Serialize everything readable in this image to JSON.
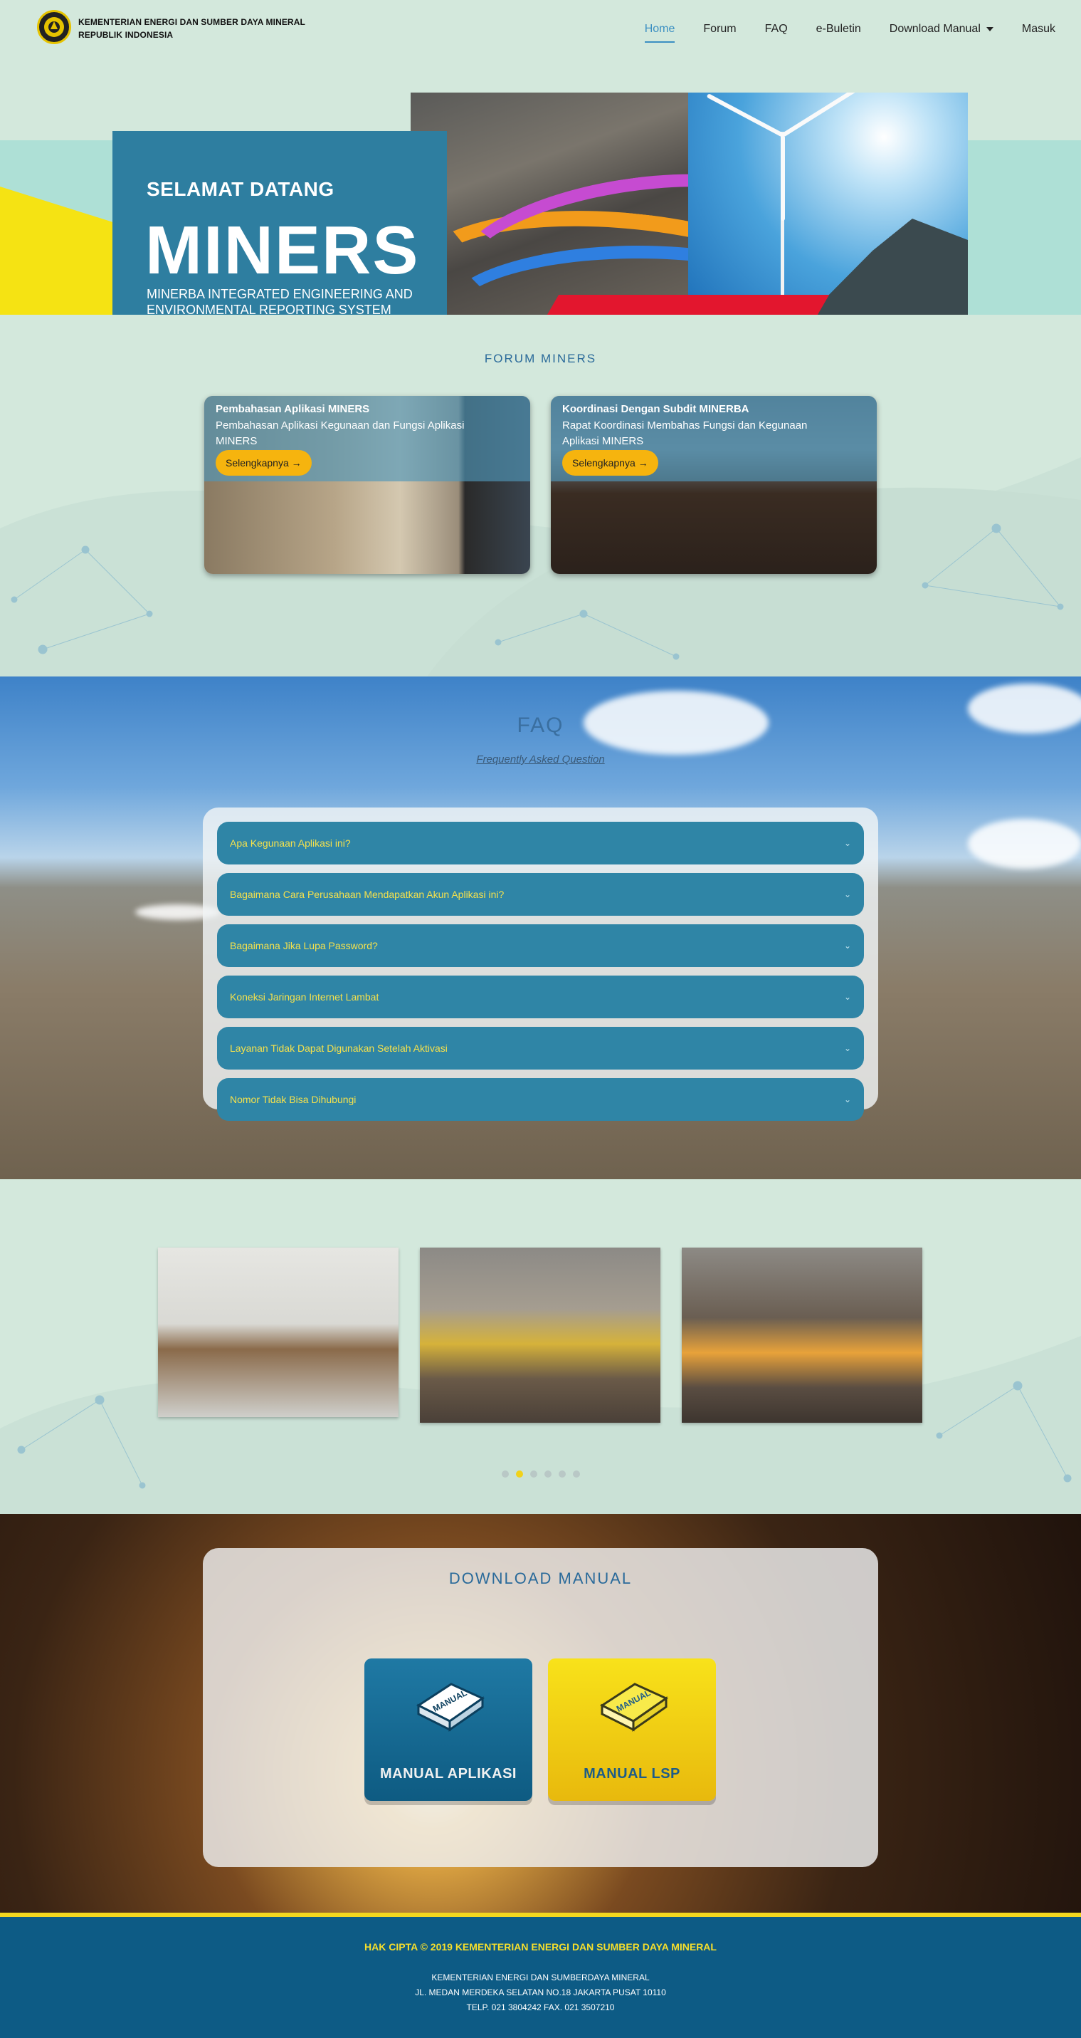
{
  "header": {
    "brand_line1": "KEMENTERIAN ENERGI DAN SUMBER DAYA MINERAL",
    "brand_line2": "REPUBLIK INDONESIA",
    "nav": [
      {
        "label": "Home"
      },
      {
        "label": "Forum"
      },
      {
        "label": "FAQ"
      },
      {
        "label": "e-Buletin"
      },
      {
        "label": "Download Manual"
      },
      {
        "label": "Masuk"
      }
    ],
    "active_nav": "Home"
  },
  "hero": {
    "welcome": "SELAMAT DATANG",
    "title": "MINERS",
    "subtitle": "MINERBA INTEGRATED ENGINEERING AND ENVIRONMENTAL REPORTING SYSTEM"
  },
  "forum": {
    "title": "FORUM MINERS",
    "cards": [
      {
        "title": "Pembahasan Aplikasi MINERS",
        "desc": "Pembahasan Aplikasi Kegunaan dan Fungsi Aplikasi MINERS",
        "button": "Selengkapnya →"
      },
      {
        "title": "Koordinasi Dengan Subdit MINERBA",
        "desc": "Rapat Koordinasi Membahas Fungsi dan Kegunaan Aplikasi MINERS",
        "button": "Selengkapnya →"
      }
    ]
  },
  "faq": {
    "title": "FAQ",
    "subtitle": "Frequently Asked Question",
    "items": [
      {
        "q": "Apa Kegunaan Aplikasi ini?"
      },
      {
        "q": "Bagaimana Cara Perusahaan Mendapatkan Akun Aplikasi ini?"
      },
      {
        "q": "Bagaimana Jika Lupa Password?"
      },
      {
        "q": "Koneksi Jaringan Internet Lambat"
      },
      {
        "q": "Layanan Tidak Dapat Digunakan Setelah Aktivasi"
      },
      {
        "q": "Nomor Tidak Bisa Dihubungi"
      }
    ]
  },
  "gallery": {
    "slide_count": 6,
    "active_slide": 2
  },
  "download": {
    "title": "DOWNLOAD MANUAL",
    "manuals": [
      {
        "label": "MANUAL APLIKASI",
        "book_text": "MANUAL"
      },
      {
        "label": "MANUAL LSP",
        "book_text": "MANUAL"
      }
    ]
  },
  "footer": {
    "copyright": "HAK CIPTA © 2019 KEMENTERIAN ENERGI DAN SUMBER DAYA MINERAL",
    "line1": "KEMENTERIAN ENERGI DAN SUMBERDAYA MINERAL",
    "line2": "JL. MEDAN MERDEKA SELATAN NO.18 JAKARTA PUSAT 10110",
    "line3": "TELP. 021 3804242 FAX. 021 3507210"
  },
  "colors": {
    "background": "#d3e8dc",
    "accent": "#2f85a6",
    "yellow": "#f5e14c",
    "footer": "#0d5b85"
  }
}
